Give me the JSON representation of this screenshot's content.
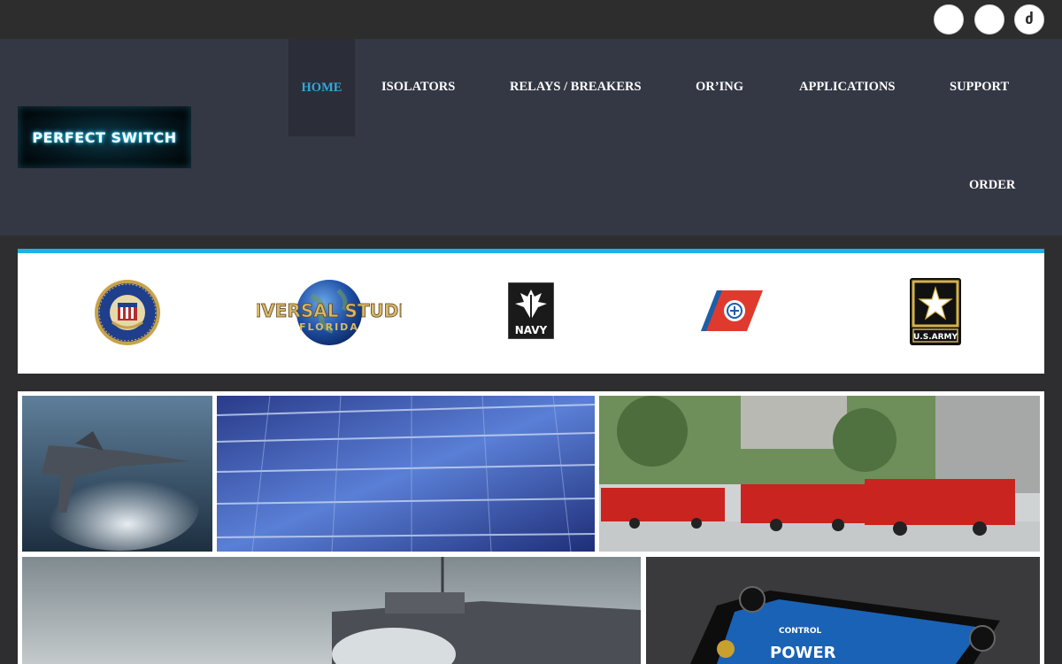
{
  "social": {
    "icons": [
      "social-icon",
      "social-icon",
      "drupal-icon"
    ],
    "icon3_glyph": "ძ"
  },
  "logo": {
    "text": "PERFECT SWITCH"
  },
  "nav": {
    "home": "HOME",
    "isolators": "ISOLATORS",
    "relays": "RELAYS / BREAKERS",
    "oring": "OR’ING",
    "applications": "APPLICATIONS",
    "support": "SUPPORT",
    "order": "ORDER"
  },
  "clients": {
    "fbi": "FBI seal",
    "universal_line1": "UNIVERSAL STUDIOS",
    "universal_line2": "FLORIDA",
    "navy": "NAVY",
    "coast_guard": "Coast Guard emblem",
    "army": "U.S.ARMY"
  },
  "collage": {
    "tiles": [
      "fighter-jet-photo",
      "solar-panel-photo",
      "fire-trucks-photo",
      "ship-photo",
      "power-module-photo"
    ],
    "module_label_1": "CONTROL",
    "module_label_2": "POWER"
  },
  "colors": {
    "accent": "#1fb1e6",
    "header_bg": "#343744",
    "topbar_bg": "#2d2d2d",
    "active_nav": "#31a8e0"
  }
}
